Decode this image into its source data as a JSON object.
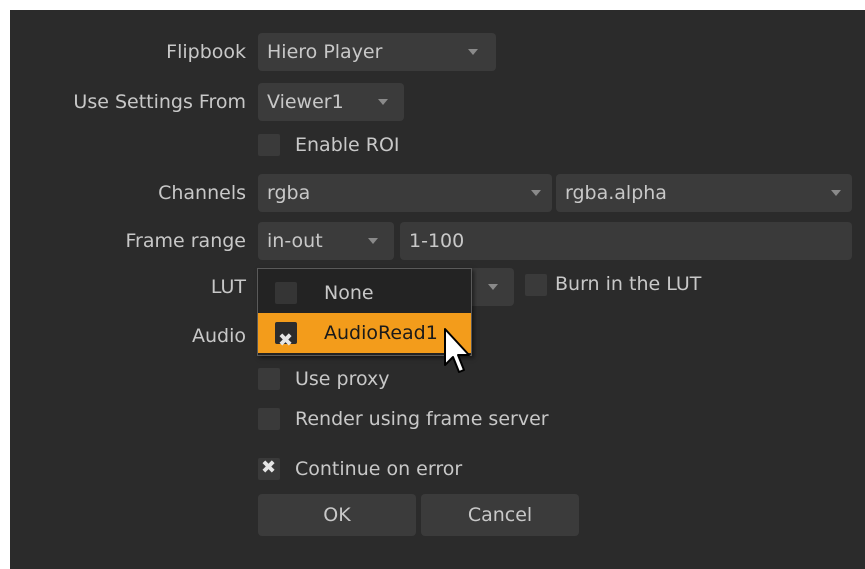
{
  "form": {
    "flipbook": {
      "label": "Flipbook",
      "value": "Hiero Player"
    },
    "use_settings_from": {
      "label": "Use Settings From",
      "value": "Viewer1"
    },
    "enable_roi": {
      "label": "Enable ROI",
      "checked": false
    },
    "channels": {
      "label": "Channels",
      "value": "rgba",
      "alpha_value": "rgba.alpha"
    },
    "frame_range": {
      "label": "Frame range",
      "mode": "in-out",
      "value": "1-100"
    },
    "lut": {
      "label": "LUT",
      "burn_in": {
        "label": "Burn in the LUT",
        "checked": false
      }
    },
    "audio": {
      "label": "Audio"
    },
    "use_proxy": {
      "label": "Use proxy",
      "checked": false
    },
    "render_frame_server": {
      "label": "Render using frame server",
      "checked": false
    },
    "continue_on_error": {
      "label": "Continue on error",
      "checked": true
    }
  },
  "popup": {
    "items": [
      {
        "label": "None",
        "checked": false,
        "selected": false
      },
      {
        "label": "AudioRead1",
        "checked": true,
        "selected": true
      }
    ]
  },
  "buttons": {
    "ok": "OK",
    "cancel": "Cancel"
  },
  "icons": {
    "checkmark": "x-check-icon",
    "dropdown": "chevron-down-icon",
    "pointer": "mouse-pointer-icon"
  },
  "colors": {
    "background": "#2b2b2b",
    "highlight": "#f39c1b",
    "text": "#c8c8c8"
  }
}
